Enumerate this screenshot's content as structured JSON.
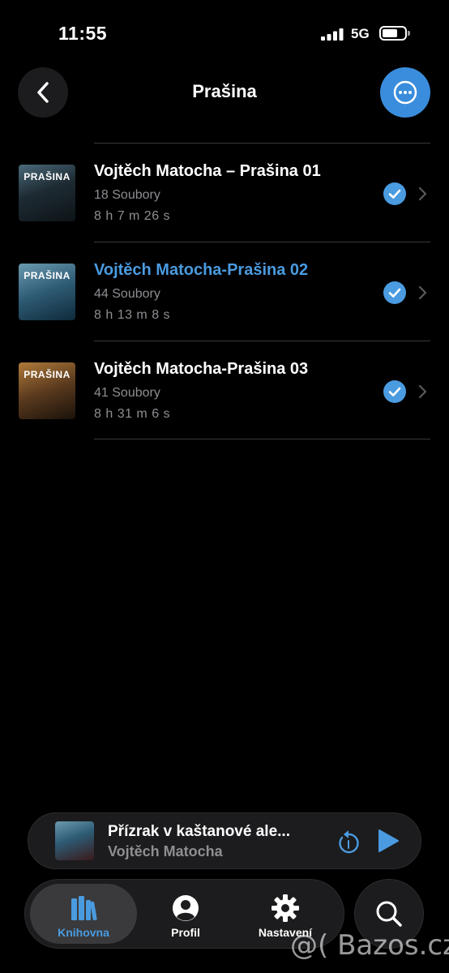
{
  "status_bar": {
    "time": "11:55",
    "network": "5G"
  },
  "header": {
    "title": "Prašina",
    "back_icon": "chevron-left-icon",
    "more_icon": "ellipsis-icon"
  },
  "books": [
    {
      "title": "Vojtěch Matocha – Prašina 01",
      "files": "18 Soubory",
      "duration": "8 h 7 m 26 s",
      "cover_text": "PRAŠINA",
      "active": false
    },
    {
      "title": "Vojtěch Matocha-Prašina 02",
      "files": "44 Soubory",
      "duration": "8 h 13 m 8 s",
      "cover_text": "PRAŠINA",
      "active": true
    },
    {
      "title": "Vojtěch Matocha-Prašina 03",
      "files": "41 Soubory",
      "duration": "8 h 31 m 6 s",
      "cover_text": "PRAŠINA",
      "active": false
    }
  ],
  "mini_player": {
    "title": "Přízrak v kaštanové ale...",
    "author": "Vojtěch Matocha"
  },
  "tabs": [
    {
      "label": "Knihovna",
      "icon": "books-icon",
      "active": true
    },
    {
      "label": "Profil",
      "icon": "person-icon",
      "active": false
    },
    {
      "label": "Nastavení",
      "icon": "gear-icon",
      "active": false
    }
  ],
  "watermark": "@( Bazos.cz",
  "colors": {
    "accent": "#4a9be0",
    "background": "#000000",
    "secondary_text": "#8e8e93"
  }
}
